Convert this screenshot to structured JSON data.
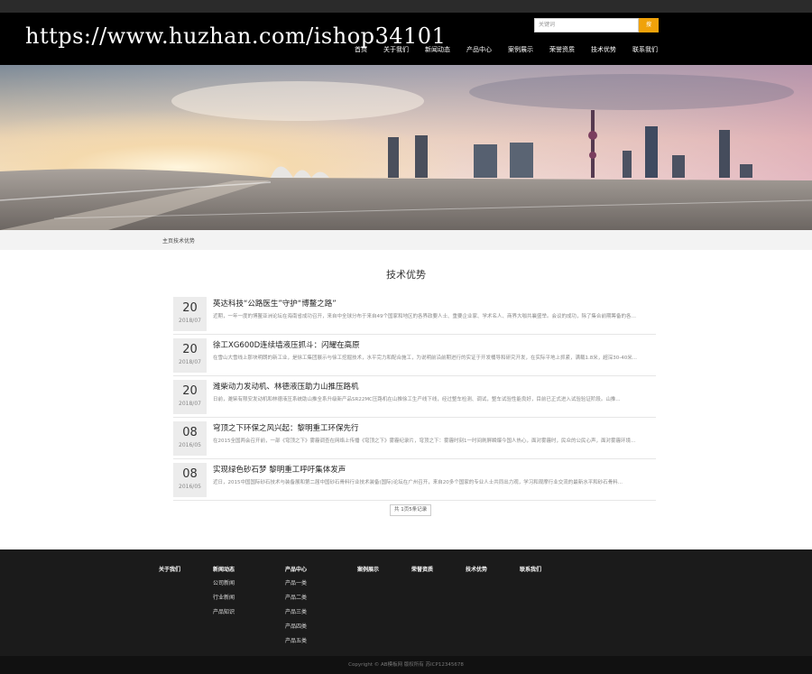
{
  "watermark": "https://www.huzhan.com/ishop34101",
  "search": {
    "placeholder": "关键词",
    "button": "搜"
  },
  "nav": [
    "首页",
    "关于我们",
    "新闻动态",
    "产品中心",
    "案例展示",
    "荣誉资质",
    "技术优势",
    "联系我们"
  ],
  "breadcrumb": "主页技术优势",
  "section_title": "技术优势",
  "news": [
    {
      "day": "20",
      "ym": "2018/07",
      "title": "英达科技“公路医生”守护“博鳌之路”",
      "summary": "近期，一年一度的博鳌亚洲论坛在海南省成功召开，来自中全球分布于来自49个国家和地区的各界政要人士、重要企业家、学术名人、商界大咖共襄盛举。会议的成功，除了集合前期筹备的各界所努力外，也需要完善的道路保障..."
    },
    {
      "day": "20",
      "ym": "2018/07",
      "title": "徐工XG600D连续墙液压抓斗：闪耀在高原",
      "summary": "在雪山大雪线上那块明朗的新工业，是徐工集团展示与徐工挖掘技术，水平完力和配合施工，为说明前沿前期进行的实证于开发桶导和研究开发，在实际平地上抓紧，满载1.8米，超深30-40米..."
    },
    {
      "day": "20",
      "ym": "2018/07",
      "title": "潍柴动力发动机、林德液压助力山推压路机",
      "summary": "日前，潍柴有限安发动机和林德液压系统助山推全系升级新产品SR22MC压路机在山推徐工生产线下线，经过整车检测、调试，整车试验性能良好，目前已正式进入试验验证阶段。山推..."
    },
    {
      "day": "08",
      "ym": "2016/05",
      "title": "穹顶之下环保之风兴起：黎明重工环保先行",
      "summary": "在2015全国两会召开前，一部《穹顶之下》雾霾调查在网络上传播《穹顶之下》雾霾纪录片，穹顶之下：雾霾时刻1一时间刷屏瞬爆今国人热心，面对雾霾时，民众的公民心声，面对雾霾环境..."
    },
    {
      "day": "08",
      "ym": "2016/05",
      "title": "实现绿色砂石梦 黎明重工呼吁集体发声",
      "summary": "近日，2015中国国际砂石技术与装备展和第二届中国砂石骨料行业技术装备(国际)论坛在广州召开，来自20多个国家的专业人士共同出力观，学习和观摩行业交流的最新水平和砂石骨料..."
    }
  ],
  "pager": "共 1页5条记录",
  "footer": {
    "columns": [
      {
        "head": "关于我们",
        "links": []
      },
      {
        "head": "新闻动态",
        "links": [
          "公司新闻",
          "行业新闻",
          "产品知识"
        ]
      },
      {
        "head": "产品中心",
        "links": [
          "产品一类",
          "产品二类",
          "产品三类",
          "产品四类",
          "产品五类"
        ]
      },
      {
        "head": "案例展示",
        "links": []
      },
      {
        "head": "荣誉资质",
        "links": []
      },
      {
        "head": "技术优势",
        "links": []
      },
      {
        "head": "联系我们",
        "links": []
      }
    ],
    "copyright": "Copyright © AB模板网 版权所有 苏ICP12345678"
  },
  "colors": {
    "accent": "#f0a20a",
    "header_bg": "#000000",
    "footer_bg": "#1b1b1b"
  }
}
